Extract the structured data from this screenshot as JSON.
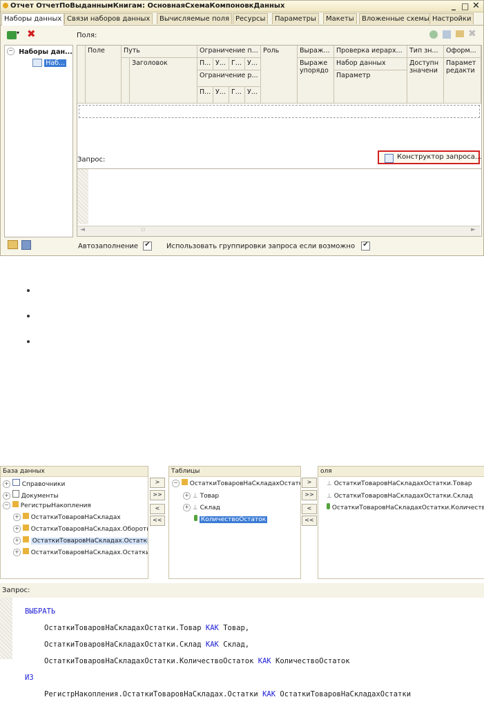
{
  "window": {
    "title": "Отчет ОтчетПоВыданнымКнигам: ОсновнаяСхемаКомпоновкиДанных",
    "title_shown": "Отчет ОтчетПоВыданнымКнигам: ОсновнаяСхемаКомпоновкДанных",
    "controls": [
      "_",
      "□",
      "✕"
    ]
  },
  "tabs": [
    "Наборы данных",
    "Связи наборов данных",
    "Вычисляемые поля",
    "Ресурсы",
    "Параметры",
    "Макеты",
    "Вложенные схемы",
    "Настройки"
  ],
  "tree": {
    "root": "Наборы дан...",
    "child": "Наб..."
  },
  "fields_label": "Поля:",
  "grid": {
    "headers": {
      "field": "Поле",
      "path": "Путь",
      "title": "Заголовок",
      "restrict_field": "Ограничение п...",
      "r1": [
        "П...",
        "У...",
        "Г...",
        "У..."
      ],
      "restrict_req": "Ограничение р...",
      "r2": [
        "П...",
        "У...",
        "Г...",
        "У..."
      ],
      "role": "Роль",
      "expr": "Выраж...",
      "expr2": "Выраже упорядо",
      "hier": "Проверка иерарх...",
      "dataset": "Набор данных",
      "param": "Параметр",
      "type": "Тип зн...",
      "avail": "Доступн значени",
      "fmt": "Оформ...",
      "edit": "Парамет редакти"
    }
  },
  "query_label": "Запрос:",
  "query_builder_button": "Конструктор запроса...",
  "autofill_label": "Автозаполнение",
  "use_grouping_label": "Использовать группировки запроса если возможно",
  "builder": {
    "db_header": "База данных",
    "tables_header": "Таблицы",
    "fields_header": "оля",
    "db_items": [
      "Справочники",
      "Документы",
      "РегистрыНакопления",
      "ОстаткиТоваровНаСкладах",
      "ОстаткиТоваровНаСкладах.Обороты",
      "ОстаткиТоваровНаСкладах.Остатки",
      "ОстаткиТоваровНаСкладах.ОстаткиИС"
    ],
    "table_items": [
      "ОстаткиТоваровНаСкладахОстатки",
      "Товар",
      "Склад",
      "КоличествоОстаток"
    ],
    "field_items": [
      "ОстаткиТоваровНаСкладахОстатки.Товар",
      "ОстаткиТоваровНаСкладахОстатки.Склад",
      "ОстаткиТоваровНаСкладахОстатки.КоличествоО"
    ],
    "buttons": [
      ">",
      ">>",
      "<",
      "<<"
    ]
  },
  "query2_label": "Запрос:",
  "query_text": {
    "select": "ВЫБРАТЬ",
    "l1a": "ОстаткиТоваровНаСкладахОстатки.Товар ",
    "as": "КАК",
    "l1b": " Товар,",
    "l2a": "ОстаткиТоваровНаСкладахОстатки.Склад ",
    "l2b": " Склад,",
    "l3a": "ОстаткиТоваровНаСкладахОстатки.КоличествоОстаток ",
    "l3b": " КоличествоОстаток",
    "from": "ИЗ",
    "l4a": "РегистрНакопления.ОстаткиТоваровНаСкладах.Остатки ",
    "l4b": " ОстаткиТоваровНаСкладахОстатки"
  },
  "colors": {
    "accent_red": "#d21f1f",
    "keyword": "#1f1fd8",
    "selection": "#3a7bd5"
  }
}
